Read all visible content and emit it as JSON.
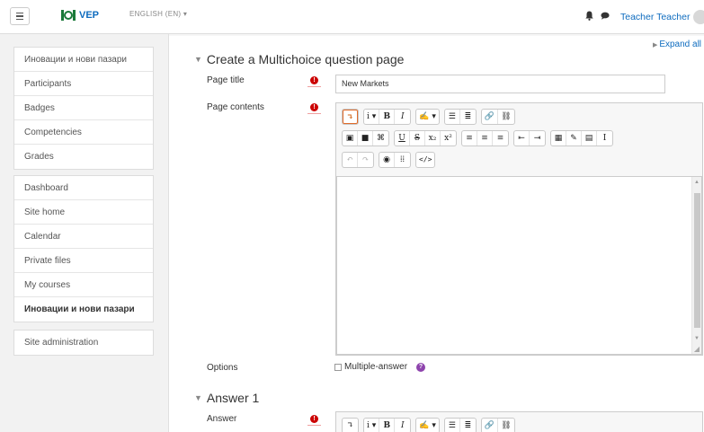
{
  "navbar": {
    "site_name": "VEP",
    "language": "ENGLISH (EN) ▾",
    "user_name": "Teacher Teacher",
    "icons": [
      "hamburger-icon",
      "logo-icon",
      "bell-icon",
      "chat-icon",
      "avatar"
    ]
  },
  "sidebar": {
    "group1": [
      {
        "label": "Иновации и нови пазари"
      },
      {
        "label": "Participants"
      },
      {
        "label": "Badges"
      },
      {
        "label": "Competencies"
      },
      {
        "label": "Grades"
      }
    ],
    "group2": [
      {
        "label": "Dashboard"
      },
      {
        "label": "Site home"
      },
      {
        "label": "Calendar"
      },
      {
        "label": "Private files"
      },
      {
        "label": "My courses"
      },
      {
        "label": "Иновации и нови пазари"
      }
    ],
    "group3": [
      {
        "label": "Site administration"
      }
    ]
  },
  "main": {
    "expand_all": "Expand all",
    "section_title": "Create a Multichoice question page",
    "page_title_label": "Page title",
    "page_title_value": "New Markets",
    "page_contents_label": "Page contents",
    "options_label": "Options",
    "multiple_answer_label": "Multiple-answer",
    "answer_section_title": "Answer 1",
    "answer_label": "Answer"
  },
  "toolbar": {
    "row1": [
      [
        "↴"
      ],
      [
        "i ▾",
        "B",
        "I"
      ],
      [
        "✍ ▾"
      ],
      [
        "☰",
        "≣"
      ],
      [
        "🔗",
        "⛓"
      ]
    ],
    "row2": [
      [
        "▣",
        "■",
        "⌘"
      ],
      [
        "U",
        "S",
        "x₂",
        "x²"
      ],
      [
        "≡",
        "≡",
        "≡"
      ],
      [
        "⇤",
        "⇥"
      ],
      [
        "▦",
        "✎",
        "▤",
        "Ι"
      ]
    ],
    "row3": [
      [
        "↶",
        "↷"
      ],
      [
        "◉",
        "⁞⁞"
      ],
      [
        "</>"
      ]
    ]
  },
  "colors": {
    "accent": "#0f6cbf",
    "required": "#cc0000",
    "help": "#8e44ad"
  }
}
